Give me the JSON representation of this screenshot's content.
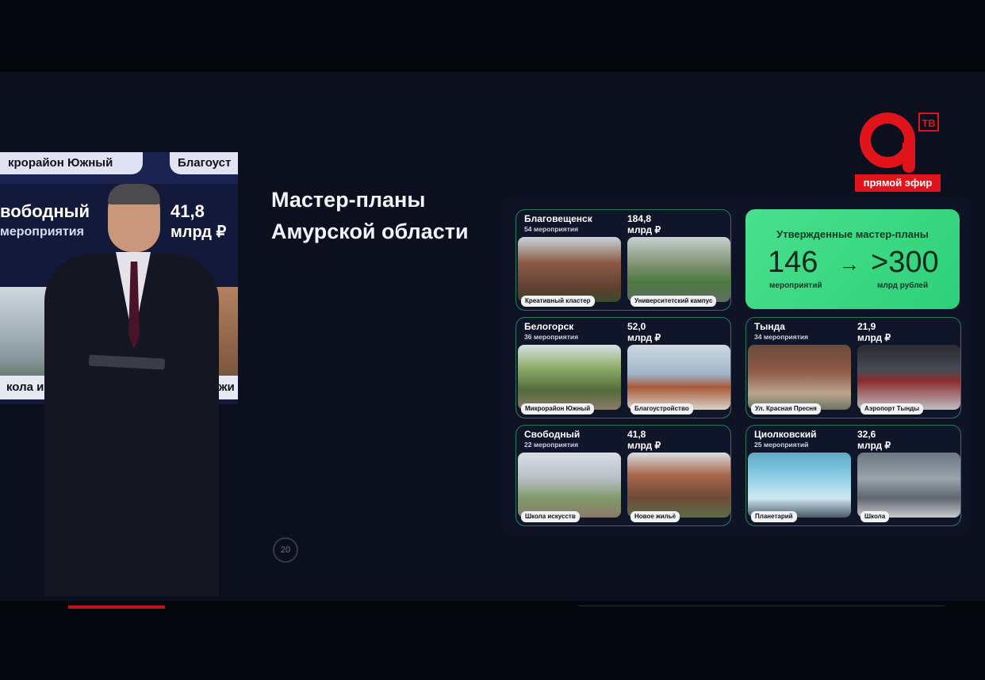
{
  "broadcast": {
    "logo_letter": "a",
    "tv_label": "ТВ",
    "live_label": "прямой эфир"
  },
  "stage_screen": {
    "chip_left": "крорайон Южный",
    "chip_right": "Благоуст",
    "city": "вободный",
    "events": "мероприятия",
    "amount_line1": "41,8",
    "amount_line2": "млрд ₽",
    "caption_left": "кола искусств",
    "caption_right": "овое жи"
  },
  "slide": {
    "title": "Мастер-планы Амурской области",
    "page_number": "20",
    "summary": {
      "title": "Утвержденные мастер-планы",
      "events_value": "146",
      "events_label": "мероприятий",
      "arrow": "→",
      "amount_value": ">300",
      "amount_label": "млрд рублей"
    },
    "cities": [
      {
        "name": "Благовещенск",
        "events": "54 мероприятия",
        "amount": "184,8",
        "unit": "млрд ₽",
        "left_tag": "Креативный кластер",
        "right_tag": "Университетский кампус"
      },
      {
        "name": "Белогорск",
        "events": "36 мероприятия",
        "amount": "52,0",
        "unit": "млрд ₽",
        "left_tag": "Микрорайон Южный",
        "right_tag": "Благоустройство"
      },
      {
        "name": "Тында",
        "events": "34 мероприятия",
        "amount": "21,9",
        "unit": "млрд ₽",
        "left_tag": "Ул. Красная Пресня",
        "right_tag": "Аэропорт Тынды"
      },
      {
        "name": "Свободный",
        "events": "22 мероприятия",
        "amount": "41,8",
        "unit": "млрд ₽",
        "left_tag": "Школа искусств",
        "right_tag": "Новое жильё"
      },
      {
        "name": "Циолковский",
        "events": "25 мероприятий",
        "amount": "32,6",
        "unit": "млрд ₽",
        "left_tag": "Планетарий",
        "right_tag": "Школа"
      }
    ]
  }
}
